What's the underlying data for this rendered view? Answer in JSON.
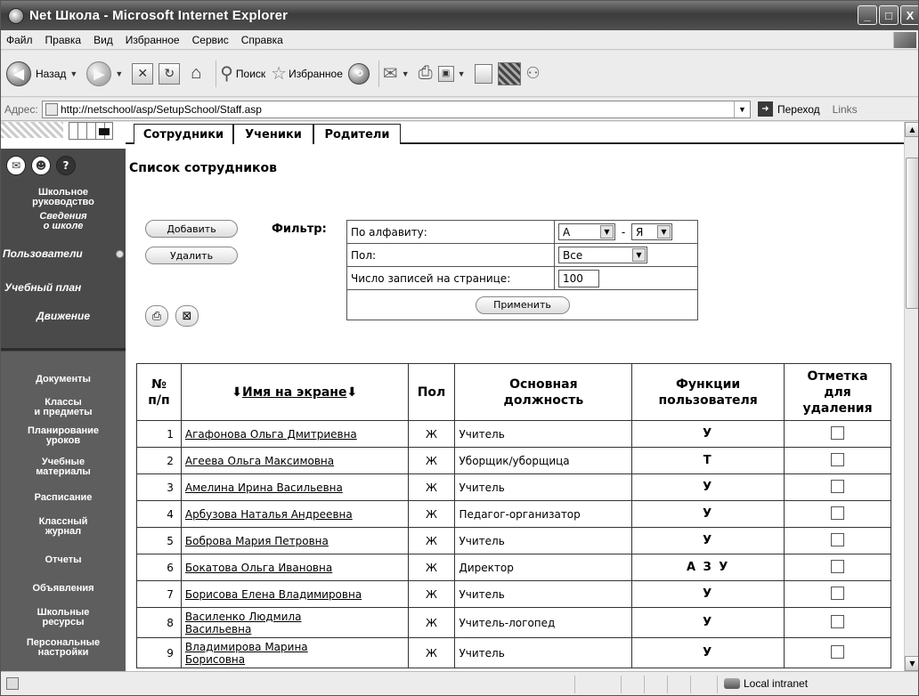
{
  "window": {
    "title": "Net Школа - Microsoft Internet Explorer",
    "buttons": [
      "_",
      "□",
      "X"
    ]
  },
  "menu": [
    "Файл",
    "Правка",
    "Вид",
    "Избранное",
    "Сервис",
    "Справка"
  ],
  "toolbar": {
    "back": "Назад",
    "search": "Поиск",
    "favorites": "Избранное"
  },
  "address": {
    "label": "Адрес:",
    "url": "http://netschool/asp/SetupSchool/Staff.asp",
    "go": "Переход",
    "links": "Links"
  },
  "sidebar": {
    "items": [
      {
        "label": "Школьное руководство"
      },
      {
        "label": "Сведения о школе"
      },
      {
        "label": "Пользователи"
      },
      {
        "label": "Учебный план"
      },
      {
        "label": "Движение"
      },
      {
        "label": "Документы"
      },
      {
        "label": "Классы и предметы"
      },
      {
        "label": "Планирование уроков"
      },
      {
        "label": "Учебные материалы"
      },
      {
        "label": "Расписание"
      },
      {
        "label": "Классный журнал"
      },
      {
        "label": "Отчеты"
      },
      {
        "label": "Объявления"
      },
      {
        "label": "Школьные ресурсы"
      },
      {
        "label": "Персональные настройки"
      }
    ],
    "lines": {
      "i0a": "Школьное",
      "i0b": "руководство",
      "i1a": "Сведения",
      "i1b": "о школе",
      "i6a": "Классы",
      "i6b": "и предметы",
      "i7a": "Планирование",
      "i7b": "уроков",
      "i8a": "Учебные",
      "i8b": "материалы",
      "i10a": "Классный",
      "i10b": "журнал",
      "i13a": "Школьные",
      "i13b": "ресурсы",
      "i14a": "Персональные",
      "i14b": "настройки"
    }
  },
  "tabs": [
    "Сотрудники",
    "Ученики",
    "Родители"
  ],
  "page_title": "Список сотрудников",
  "actions": {
    "add": "Добавить",
    "delete": "Удалить"
  },
  "filter": {
    "label": "Фильтр:",
    "alphabet_label": "По алфавиту:",
    "from": "А",
    "dash": "-",
    "to": "Я",
    "gender_label": "Пол:",
    "gender_value": "Все",
    "per_page_label": "Число записей на странице:",
    "per_page_value": "100",
    "apply": "Применить"
  },
  "table": {
    "headers": {
      "num_a": "№",
      "num_b": "п/п",
      "name": "Имя на экране",
      "gender": "Пол",
      "pos_a": "Основная",
      "pos_b": "должность",
      "func_a": "Функции",
      "func_b": "пользователя",
      "del_a": "Отметка",
      "del_b": "для",
      "del_c": "удаления"
    },
    "rows": [
      {
        "n": "1",
        "name": "Агафонова Ольга Дмитриевна",
        "name2": "",
        "g": "Ж",
        "pos": "Учитель",
        "func": "У"
      },
      {
        "n": "2",
        "name": "Агеева Ольга Максимовна",
        "name2": "",
        "g": "Ж",
        "pos": "Уборщик/уборщица",
        "func": "Т"
      },
      {
        "n": "3",
        "name": "Амелина Ирина Васильевна",
        "name2": "",
        "g": "Ж",
        "pos": "Учитель",
        "func": "У"
      },
      {
        "n": "4",
        "name": "Арбузова Наталья Андреевна",
        "name2": "",
        "g": "Ж",
        "pos": "Педагог-организатор",
        "func": "У"
      },
      {
        "n": "5",
        "name": "Боброва Мария Петровна",
        "name2": "",
        "g": "Ж",
        "pos": "Учитель",
        "func": "У"
      },
      {
        "n": "6",
        "name": "Бокатова Ольга Ивановна",
        "name2": "",
        "g": "Ж",
        "pos": "Директор",
        "func": "А З У"
      },
      {
        "n": "7",
        "name": "Борисова Елена Владимировна",
        "name2": "",
        "g": "Ж",
        "pos": "Учитель",
        "func": "У"
      },
      {
        "n": "8",
        "name": "Василенко Людмила",
        "name2": "Васильевна",
        "g": "Ж",
        "pos": "Учитель-логопед",
        "func": "У"
      },
      {
        "n": "9",
        "name": "Владимирова Марина",
        "name2": "Борисовна",
        "g": "Ж",
        "pos": "Учитель",
        "func": "У"
      }
    ]
  },
  "status": {
    "zone": "Local intranet"
  },
  "colors": {
    "sidebar": "#5e5e5e",
    "titlebar": "#4a4a4a"
  }
}
